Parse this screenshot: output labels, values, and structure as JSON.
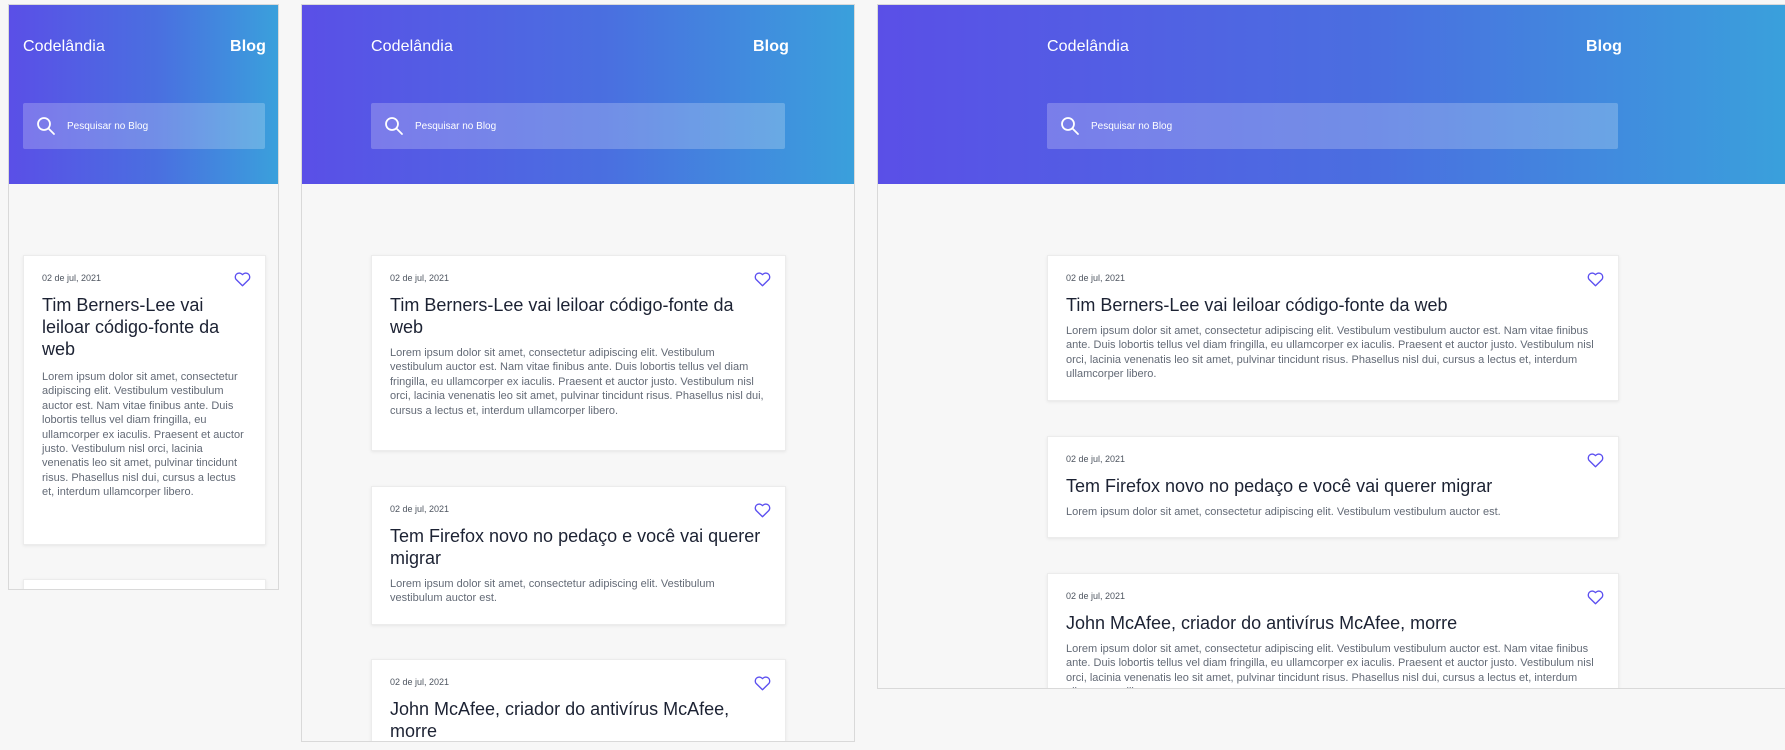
{
  "brand": "Codelândia",
  "nav": {
    "blog": "Blog"
  },
  "search": {
    "placeholder": "Pesquisar no Blog"
  },
  "colors": {
    "gradient_start": "#5a4fe7",
    "gradient_end": "#3aa0dc",
    "heart": "#5b4ff0"
  },
  "posts": [
    {
      "date": "02 de jul, 2021",
      "title": "Tim Berners-Lee vai leiloar código-fonte da web",
      "excerpt": "Lorem ipsum dolor sit amet, consectetur adipiscing elit. Vestibulum vestibulum auctor est. Nam vitae finibus ante. Duis lobortis tellus vel diam fringilla, eu ullamcorper ex iaculis. Praesent et auctor justo. Vestibulum nisl orci, lacinia venenatis leo sit amet, pulvinar tincidunt risus. Phasellus nisl dui, cursus a lectus et, interdum ullamcorper libero."
    },
    {
      "date": "02 de jul, 2021",
      "title": "Tem Firefox novo no pedaço e você vai querer migrar",
      "excerpt": "Lorem ipsum dolor sit amet, consectetur adipiscing elit. Vestibulum vestibulum auctor est."
    },
    {
      "date": "02 de jul, 2021",
      "title": "John McAfee, criador do antivírus McAfee, morre",
      "excerpt": "Lorem ipsum dolor sit amet, consectetur adipiscing elit. Vestibulum vestibulum auctor est. Nam vitae finibus ante. Duis lobortis tellus vel diam fringilla, eu ullamcorper ex iaculis. Praesent et auctor justo. Vestibulum nisl orci, lacinia venenatis leo sit amet, pulvinar tincidunt risus. Phasellus nisl dui, cursus a lectus et, interdum ullamcorper libero."
    }
  ]
}
